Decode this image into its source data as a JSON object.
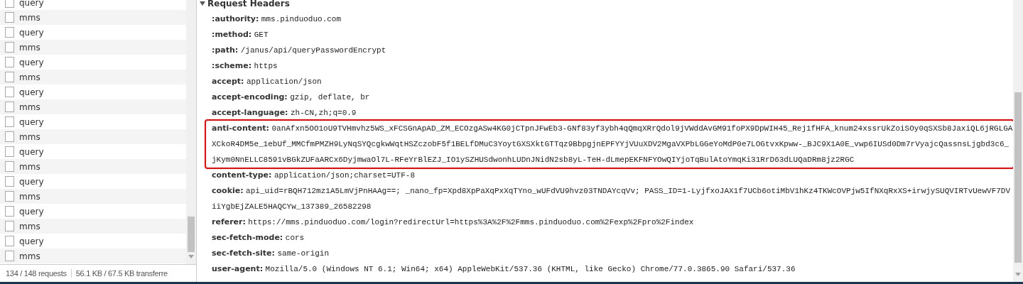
{
  "request_list": {
    "rows": [
      {
        "name": "query",
        "checked": false
      },
      {
        "name": "mms",
        "checked": false
      },
      {
        "name": "query",
        "checked": false
      },
      {
        "name": "mms",
        "checked": false
      },
      {
        "name": "query",
        "checked": false
      },
      {
        "name": "mms",
        "checked": false
      },
      {
        "name": "query",
        "checked": false
      },
      {
        "name": "mms",
        "checked": false
      },
      {
        "name": "query",
        "checked": false
      },
      {
        "name": "mms",
        "checked": false
      },
      {
        "name": "query",
        "checked": false
      },
      {
        "name": "mms",
        "checked": false
      },
      {
        "name": "query",
        "checked": false
      },
      {
        "name": "mms",
        "checked": false
      },
      {
        "name": "query",
        "checked": false
      },
      {
        "name": "mms",
        "checked": false
      },
      {
        "name": "query",
        "checked": false
      },
      {
        "name": "mms",
        "checked": false
      }
    ]
  },
  "status_bar": {
    "requests": "134 / 148 requests",
    "transferred": "56.1 KB / 67.5 KB transferre"
  },
  "headers_section": {
    "title": "Request Headers",
    "expanded": true,
    "headers": [
      {
        "name": ":authority:",
        "value": "mms.pinduoduo.com",
        "highlighted": false
      },
      {
        "name": ":method:",
        "value": "GET",
        "highlighted": false
      },
      {
        "name": ":path:",
        "value": "/janus/api/queryPasswordEncrypt",
        "highlighted": false
      },
      {
        "name": ":scheme:",
        "value": "https",
        "highlighted": false
      },
      {
        "name": "accept:",
        "value": "application/json",
        "highlighted": false
      },
      {
        "name": "accept-encoding:",
        "value": "gzip, deflate, br",
        "highlighted": false
      },
      {
        "name": "accept-language:",
        "value": "zh-CN,zh;q=0.9",
        "highlighted": false
      },
      {
        "name": "anti-content:",
        "value": "0anAfxn5OO1oU9TVHmvhz5WS_xFCSGnApAD_ZM_ECOzgASw4KG0jCTpnJFwEb3-GNf83yf3ybh4qQmqXRrQdol9jVWddAvGM91foPX9DpWIH45_Rej1fHFA_knum24xssrUkZoiSOy0qSXSb8JaxiQL6jRGLGAXCkoR4DM5e_1ebUf_MMCfmPMZH9LyNqSYQcgkwWqtHSZczobF5f1BELfDMuC3YoytGXSXktGTTqz9BbpgjnEPFYYjVUuXDV2MgaVXPbLGGeYoMdP0e7LOGtvxKpww-_BJC9X1A0E_vwp6IUSd0Dm7rVyajcQassnsLjgbd3c6_jKym0NnELLC8591vBGkZUFaARCx6DyjmwaOl7L-RFeYrBlEZJ_IO1ySZHUSdwonhLUDnJNidN2sb8yL-TeH-dLmepEKFNFYOwQIYjoTqBulAtoYmqKi31RrD63dLUQaDRm8jz2RGC",
        "highlighted": true
      },
      {
        "name": "content-type:",
        "value": "application/json;charset=UTF-8",
        "highlighted": false
      },
      {
        "name": "cookie:",
        "value": "api_uid=rBQH712mz1A5LmVjPnHAAg==; _nano_fp=Xpd8XpPaXqPxXqTYno_wUFdVU9hvz03TNDAYcqVv; PASS_ID=1-LyjfxoJAX1f7UCb6otiMbV1hKz4TKWcOVPjw5IfNXqRxXS+irwjySUQVIRTvUewVF7DViiYgbEjZALE5HAQCYw_137389_26582298",
        "highlighted": false
      },
      {
        "name": "referer:",
        "value": "https://mms.pinduoduo.com/login?redirectUrl=https%3A%2F%2Fmms.pinduoduo.com%2Fexp%2Fpro%2Findex",
        "highlighted": false
      },
      {
        "name": "sec-fetch-mode:",
        "value": "cors",
        "highlighted": false
      },
      {
        "name": "sec-fetch-site:",
        "value": "same-origin",
        "highlighted": false
      },
      {
        "name": "user-agent:",
        "value": "Mozilla/5.0 (Windows NT 6.1; Win64; x64) AppleWebKit/537.36 (KHTML, like Gecko) Chrome/77.0.3865.90 Safari/537.36",
        "highlighted": false
      }
    ]
  }
}
